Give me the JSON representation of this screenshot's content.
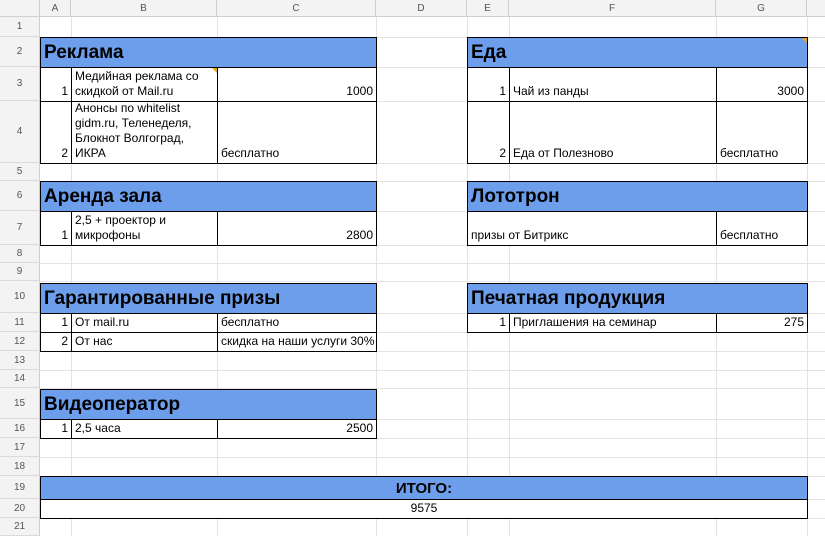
{
  "columns": [
    "A",
    "B",
    "C",
    "D",
    "E",
    "F",
    "G"
  ],
  "rows": [
    "1",
    "2",
    "3",
    "4",
    "5",
    "6",
    "7",
    "8",
    "9",
    "10",
    "11",
    "12",
    "13",
    "14",
    "15",
    "16",
    "17",
    "18",
    "19",
    "20",
    "21"
  ],
  "sections": {
    "reklama": {
      "title": "Реклама",
      "items": [
        {
          "num": "1",
          "name": "Медийная реклама со скидкой от Mail.ru",
          "price": "1000"
        },
        {
          "num": "2",
          "name": "Анонсы по whitelist gidm.ru, Теленеделя, Блокнот Волгоград, ИКРА",
          "price": "бесплатно"
        }
      ]
    },
    "eda": {
      "title": "Еда",
      "items": [
        {
          "num": "1",
          "name": "Чай из панды",
          "price": "3000"
        },
        {
          "num": "2",
          "name": "Еда от Полезново",
          "price": "бесплатно"
        }
      ]
    },
    "arenda": {
      "title": "Аренда зала",
      "items": [
        {
          "num": "1",
          "name": "2,5 + проектор и микрофоны",
          "price": "2800"
        }
      ]
    },
    "lototron": {
      "title": "Лототрон",
      "items": [
        {
          "name": "призы от Битрикс",
          "price": "бесплатно"
        }
      ]
    },
    "prizes": {
      "title": "Гарантированные призы",
      "items": [
        {
          "num": "1",
          "name": "От mail.ru",
          "price": "бесплатно"
        },
        {
          "num": "2",
          "name": "От нас",
          "price": "скидка на наши услуги 30%"
        }
      ]
    },
    "print": {
      "title": "Печатная продукция",
      "items": [
        {
          "num": "1",
          "name": "Приглашения на семинар",
          "price": "275"
        }
      ]
    },
    "video": {
      "title": "Видеоператор",
      "items": [
        {
          "num": "1",
          "name": "2,5 часа",
          "price": "2500"
        }
      ]
    }
  },
  "total": {
    "label": "ИТОГО:",
    "value": "9575"
  },
  "colors": {
    "band": "#6d9eeb",
    "header_bg": "#f3f3f3",
    "grid": "#e3e3e3",
    "note": "#e6a817"
  }
}
